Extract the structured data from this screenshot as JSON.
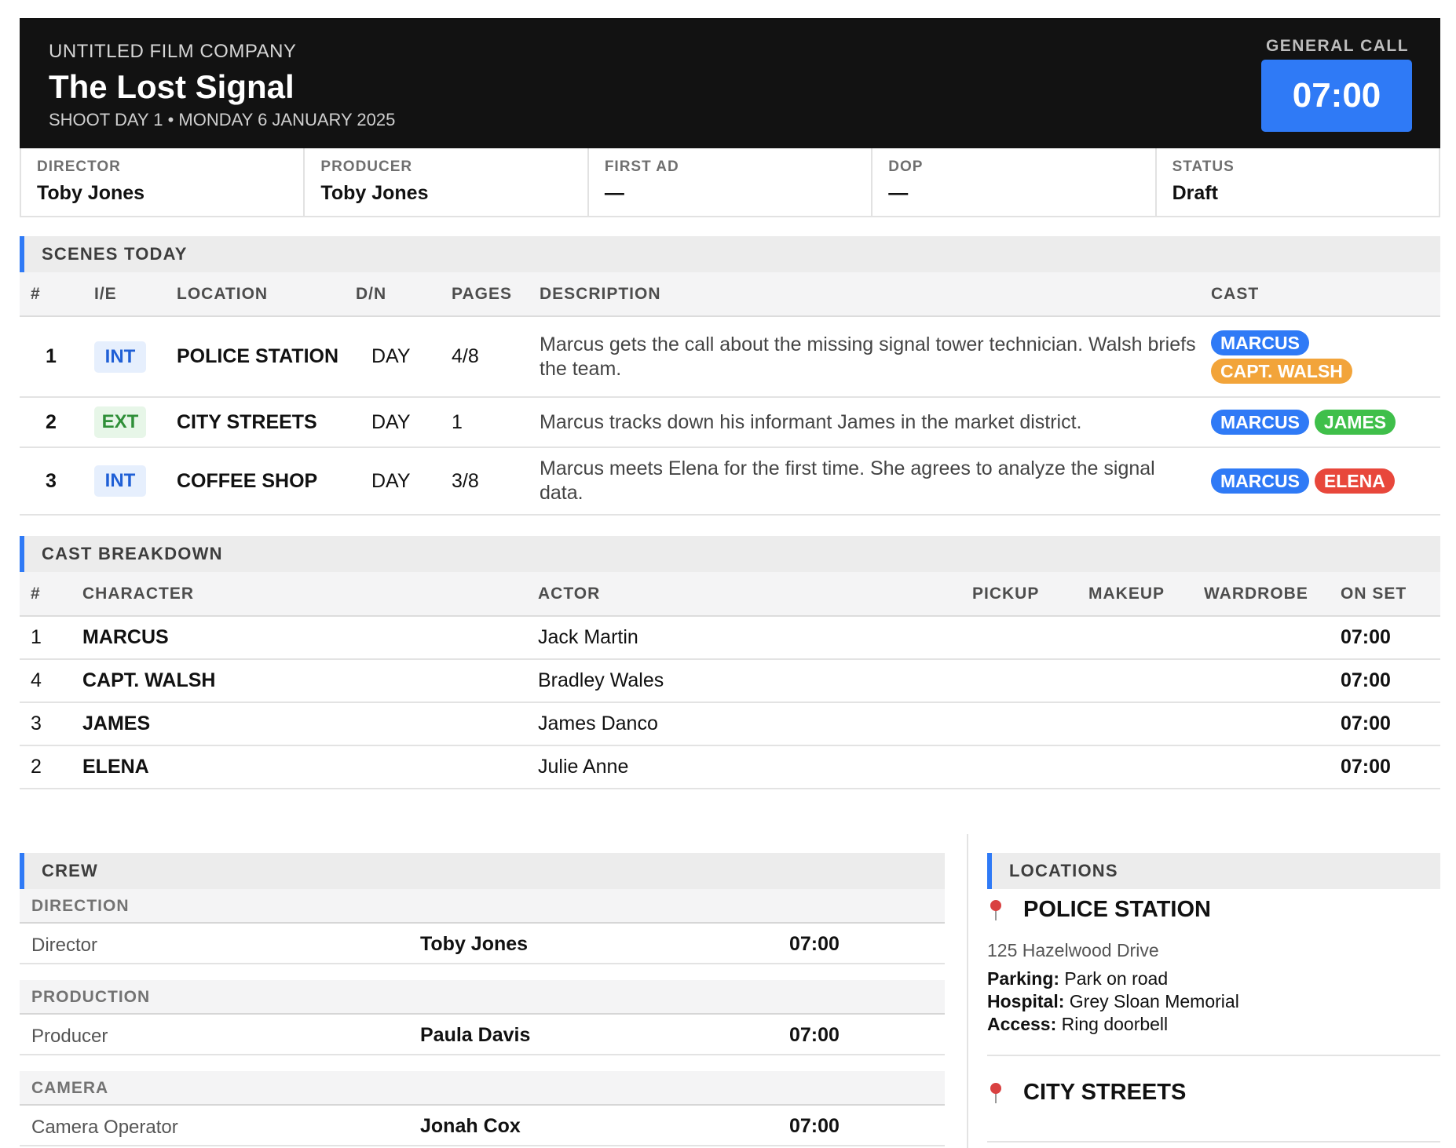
{
  "header": {
    "company": "UNTITLED FILM COMPANY",
    "title": "The Lost Signal",
    "shoot_day": "SHOOT DAY 1 • MONDAY 6 JANUARY 2025",
    "general_call_label": "GENERAL CALL",
    "general_call_time": "07:00"
  },
  "info": [
    {
      "label": "DIRECTOR",
      "value": "Toby Jones"
    },
    {
      "label": "PRODUCER",
      "value": "Toby Jones"
    },
    {
      "label": "FIRST AD",
      "value": "—"
    },
    {
      "label": "DOP",
      "value": "—"
    },
    {
      "label": "STATUS",
      "value": "Draft"
    }
  ],
  "scenes": {
    "title": "SCENES TODAY",
    "columns": [
      "#",
      "I/E",
      "LOCATION",
      "D/N",
      "PAGES",
      "DESCRIPTION",
      "CAST"
    ],
    "rows": [
      {
        "num": "1",
        "ie": "INT",
        "location": "POLICE STATION",
        "dn": "DAY",
        "pages": "4/8",
        "description": "Marcus gets the call about the missing signal tower technician. Walsh briefs the team.",
        "cast": [
          "MARCUS",
          "CAPT. WALSH"
        ]
      },
      {
        "num": "2",
        "ie": "EXT",
        "location": "CITY STREETS",
        "dn": "DAY",
        "pages": "1",
        "description": "Marcus tracks down his informant James in the market district.",
        "cast": [
          "MARCUS",
          "JAMES"
        ]
      },
      {
        "num": "3",
        "ie": "INT",
        "location": "COFFEE SHOP",
        "dn": "DAY",
        "pages": "3/8",
        "description": "Marcus meets Elena for the first time. She agrees to analyze the signal data.",
        "cast": [
          "MARCUS",
          "ELENA"
        ]
      }
    ]
  },
  "cast": {
    "title": "CAST BREAKDOWN",
    "columns": [
      "#",
      "CHARACTER",
      "ACTOR",
      "PICKUP",
      "MAKEUP",
      "WARDROBE",
      "ON SET"
    ],
    "rows": [
      {
        "num": "1",
        "character": "MARCUS",
        "actor": "Jack Martin",
        "pickup": "",
        "makeup": "",
        "wardrobe": "",
        "on_set": "07:00"
      },
      {
        "num": "4",
        "character": "CAPT. WALSH",
        "actor": "Bradley Wales",
        "pickup": "",
        "makeup": "",
        "wardrobe": "",
        "on_set": "07:00"
      },
      {
        "num": "3",
        "character": "JAMES",
        "actor": "James Danco",
        "pickup": "",
        "makeup": "",
        "wardrobe": "",
        "on_set": "07:00"
      },
      {
        "num": "2",
        "character": "ELENA",
        "actor": "Julie Anne",
        "pickup": "",
        "makeup": "",
        "wardrobe": "",
        "on_set": "07:00"
      }
    ]
  },
  "crew": {
    "title": "CREW",
    "departments": [
      {
        "name": "DIRECTION",
        "members": [
          {
            "role": "Director",
            "name": "Toby Jones",
            "time": "07:00"
          }
        ]
      },
      {
        "name": "PRODUCTION",
        "members": [
          {
            "role": "Producer",
            "name": "Paula Davis",
            "time": "07:00"
          }
        ]
      },
      {
        "name": "CAMERA",
        "members": [
          {
            "role": "Camera Operator",
            "name": "Jonah Cox",
            "time": "07:00"
          }
        ]
      }
    ]
  },
  "locations": {
    "title": "LOCATIONS",
    "items": [
      {
        "name": "POLICE STATION",
        "address": "125 Hazelwood Drive",
        "parking_label": "Parking:",
        "parking": "Park on road",
        "hospital_label": "Hospital:",
        "hospital": "Grey Sloan Memorial",
        "access_label": "Access:",
        "access": "Ring doorbell"
      },
      {
        "name": "CITY STREETS"
      }
    ]
  },
  "colors": {
    "accent": "#2f7af6",
    "header_bg": "#121212",
    "marcus": "#2f7af6",
    "capt_walsh": "#f2a43a",
    "james": "#3fbf4a",
    "elena": "#e8473b"
  }
}
